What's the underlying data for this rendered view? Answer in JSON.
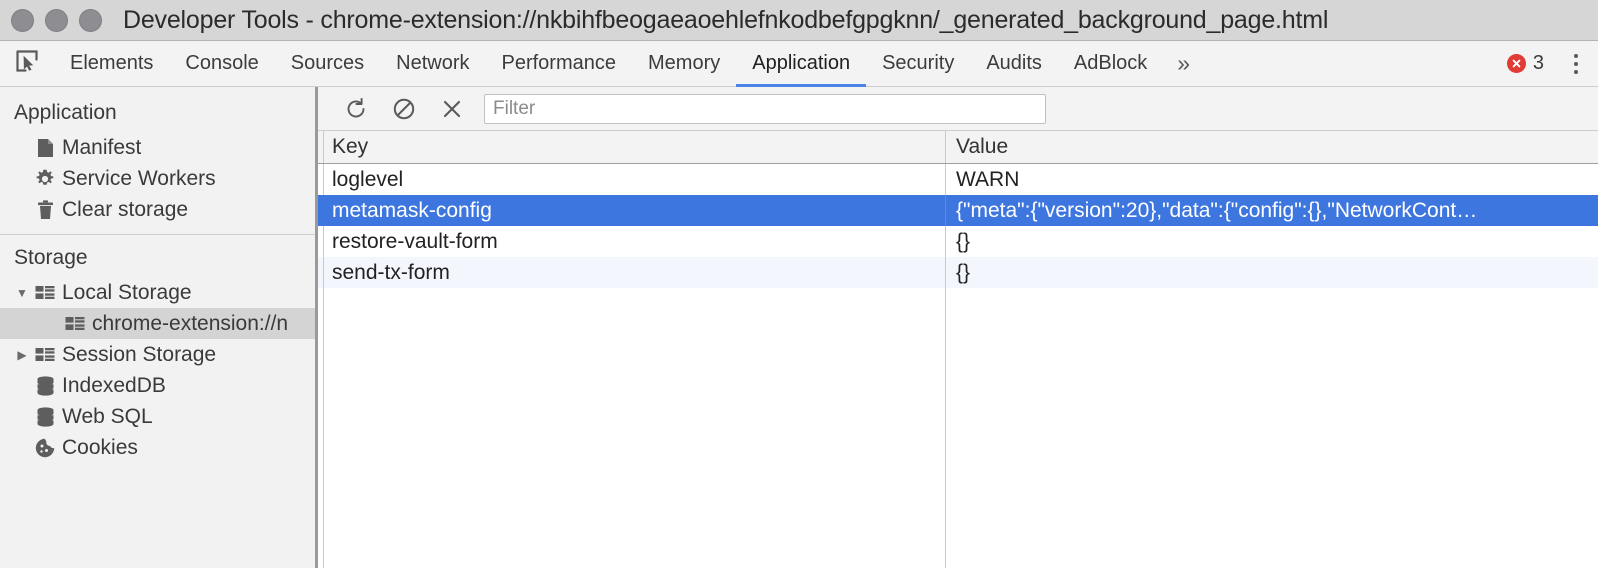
{
  "window": {
    "title": "Developer Tools - chrome-extension://nkbihfbeogaeaoehlefnkodbefgpgknn/_generated_background_page.html",
    "traffic_lights": [
      "close",
      "minimize",
      "zoom"
    ]
  },
  "tabbar": {
    "inspect_icon": "inspect-element-icon",
    "tabs": [
      {
        "label": "Elements",
        "active": false
      },
      {
        "label": "Console",
        "active": false
      },
      {
        "label": "Sources",
        "active": false
      },
      {
        "label": "Network",
        "active": false
      },
      {
        "label": "Performance",
        "active": false
      },
      {
        "label": "Memory",
        "active": false
      },
      {
        "label": "Application",
        "active": true
      },
      {
        "label": "Security",
        "active": false
      },
      {
        "label": "Audits",
        "active": false
      },
      {
        "label": "AdBlock",
        "active": false
      }
    ],
    "overflow_label": "»",
    "error_count": "3",
    "error_icon": "error-circle-icon",
    "menu_icon": "more-vertical-icon",
    "active_underline_color": "#4d82e8"
  },
  "sidebar": {
    "sections": [
      {
        "title": "Application",
        "items": [
          {
            "label": "Manifest",
            "icon": "document-icon",
            "selected": false
          },
          {
            "label": "Service Workers",
            "icon": "gear-icon",
            "selected": false
          },
          {
            "label": "Clear storage",
            "icon": "trash-icon",
            "selected": false
          }
        ]
      },
      {
        "title": "Storage",
        "items": [
          {
            "label": "Local Storage",
            "icon": "table-icon",
            "selected": false,
            "twisty": "▼"
          },
          {
            "label": "chrome-extension://n",
            "icon": "table-icon",
            "selected": true,
            "child": true
          },
          {
            "label": "Session Storage",
            "icon": "table-icon",
            "selected": false,
            "twisty": "▶"
          },
          {
            "label": "IndexedDB",
            "icon": "database-icon",
            "selected": false
          },
          {
            "label": "Web SQL",
            "icon": "database-icon",
            "selected": false
          },
          {
            "label": "Cookies",
            "icon": "cookie-icon",
            "selected": false
          }
        ]
      }
    ]
  },
  "panel": {
    "toolbar": {
      "refresh_icon": "refresh-icon",
      "clear_icon": "clear-all-icon",
      "delete_icon": "delete-selected-icon",
      "filter_placeholder": "Filter",
      "filter_value": ""
    },
    "table": {
      "columns": [
        "Key",
        "Value"
      ],
      "rows": [
        {
          "key": "loglevel",
          "value": "WARN",
          "selected": false
        },
        {
          "key": "metamask-config",
          "value": "{\"meta\":{\"version\":20},\"data\":{\"config\":{},\"NetworkCont…",
          "selected": true
        },
        {
          "key": "restore-vault-form",
          "value": "{}",
          "selected": false
        },
        {
          "key": "send-tx-form",
          "value": "{}",
          "selected": false
        }
      ],
      "selection_color": "#3e76e0"
    }
  }
}
